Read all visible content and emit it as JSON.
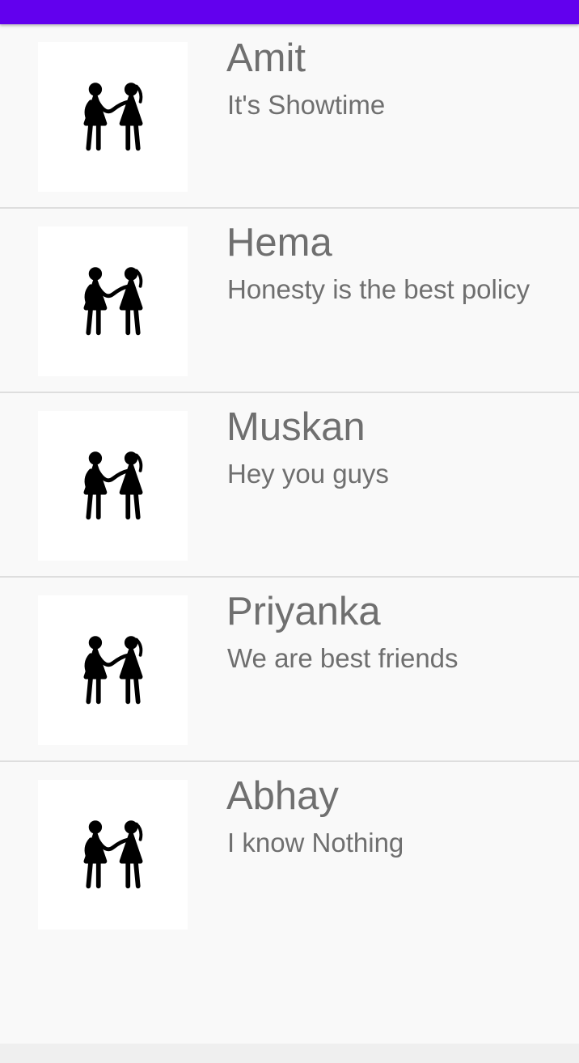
{
  "theme": {
    "status_bar_color": "#6200ee",
    "text_color": "#6f6f6f",
    "background": "#f9f9f9"
  },
  "contacts": [
    {
      "name": "Amit",
      "status": "It's Showtime",
      "avatar_icon": "friends-holding-hands-icon"
    },
    {
      "name": "Hema",
      "status": "Honesty is the best policy",
      "avatar_icon": "friends-holding-hands-icon"
    },
    {
      "name": "Muskan",
      "status": "Hey you guys",
      "avatar_icon": "friends-holding-hands-icon"
    },
    {
      "name": "Priyanka",
      "status": "We are best friends",
      "avatar_icon": "friends-holding-hands-icon"
    },
    {
      "name": "Abhay",
      "status": "I know Nothing",
      "avatar_icon": "friends-holding-hands-icon"
    }
  ]
}
